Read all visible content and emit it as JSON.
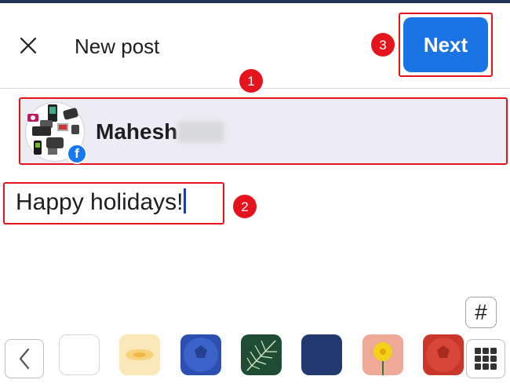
{
  "header": {
    "title": "New post",
    "next_label": "Next",
    "close_icon": "close-icon"
  },
  "annotations": {
    "badge_1": "1",
    "badge_2": "2",
    "badge_3": "3",
    "color": "#e5141c"
  },
  "account": {
    "name": "Mahesh",
    "surname_redacted": true,
    "platform_icon": "facebook-icon"
  },
  "composer": {
    "text": "Happy holidays!"
  },
  "toolbar": {
    "hashtag_label": "#",
    "back_icon": "chevron-left-icon",
    "more_icon": "grid-icon",
    "backgrounds": [
      {
        "name": "plain-white",
        "color": "#ffffff"
      },
      {
        "name": "cream-pattern",
        "color": "#fbe8b8"
      },
      {
        "name": "blue-ball",
        "color": "#2d4fb0"
      },
      {
        "name": "palm-leaf",
        "color": "#1f4d33"
      },
      {
        "name": "navy",
        "color": "#223a70"
      },
      {
        "name": "yellow-flower",
        "color": "#eea997"
      },
      {
        "name": "red-ball",
        "color": "#c9362a"
      }
    ]
  },
  "colors": {
    "accent": "#1b74e4",
    "text": "#1c1e21",
    "row_bg": "#ececf2",
    "top_strip": "#1f3354"
  }
}
